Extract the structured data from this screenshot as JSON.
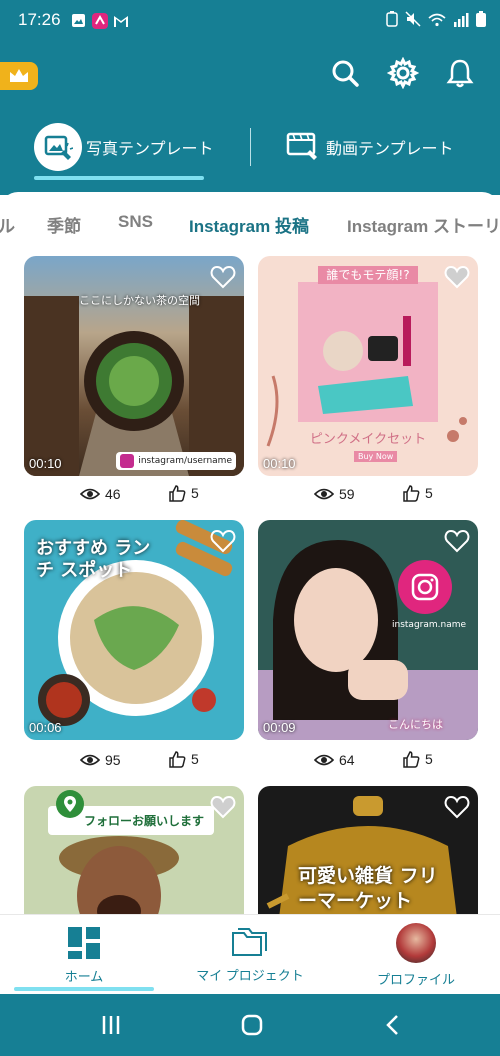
{
  "status_bar": {
    "time": "17:26"
  },
  "header": {
    "tabs": [
      {
        "label": "写真テンプレート"
      },
      {
        "label": "動画テンプレート"
      }
    ]
  },
  "categories": [
    "ル",
    "季節",
    "SNS",
    "Instagram 投稿",
    "Instagram ストーリ"
  ],
  "cards": [
    {
      "title": "ここにしかない茶の空間",
      "handle": "instagram/username",
      "duration": "00:10",
      "views": "46",
      "likes": "5"
    },
    {
      "title": "誰でもモテ顔!?",
      "subtitle": "ピンクメイクセット",
      "cta": "Buy Now",
      "duration": "00:10",
      "views": "59",
      "likes": "5"
    },
    {
      "title": "おすすめ ランチ スポット",
      "duration": "00:06",
      "views": "95",
      "likes": "5"
    },
    {
      "handle": "instagram.name",
      "caption": "こんにちは",
      "duration": "00:09",
      "views": "64",
      "likes": "5"
    },
    {
      "banner": "フォローお願いします"
    },
    {
      "title": "可愛い雑貨 フリーマーケット"
    }
  ],
  "bottom_nav": [
    {
      "label": "ホーム"
    },
    {
      "label": "マイ プロジェクト"
    },
    {
      "label": "プロファイル"
    }
  ],
  "colors": {
    "primary": "#167f94",
    "accent": "#7fe0f0",
    "crown": "#f0b21b"
  }
}
